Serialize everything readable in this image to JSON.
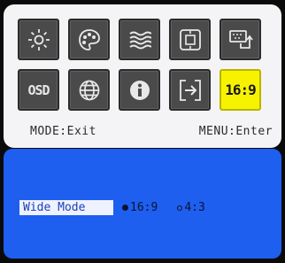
{
  "menu": {
    "icons_row1": [
      {
        "name": "brightness-icon",
        "label": ""
      },
      {
        "name": "color-icon",
        "label": ""
      },
      {
        "name": "image-adjust-icon",
        "label": ""
      },
      {
        "name": "position-icon",
        "label": ""
      },
      {
        "name": "input-source-icon",
        "label": ""
      }
    ],
    "icons_row2": [
      {
        "name": "osd-icon",
        "label": "OSD"
      },
      {
        "name": "language-icon",
        "label": ""
      },
      {
        "name": "information-icon",
        "label": ""
      },
      {
        "name": "reset-icon",
        "label": ""
      },
      {
        "name": "aspect-ratio-icon",
        "label": "16:9"
      }
    ],
    "selected_index": 9,
    "hint_left": "MODE:Exit",
    "hint_right": "MENU:Enter",
    "colors": {
      "selected": "#f7f300",
      "panel": "#1e5ff0"
    }
  },
  "submenu": {
    "label": "Wide Mode",
    "options": [
      {
        "text": "16:9",
        "selected": true
      },
      {
        "text": "4:3",
        "selected": false
      }
    ]
  }
}
